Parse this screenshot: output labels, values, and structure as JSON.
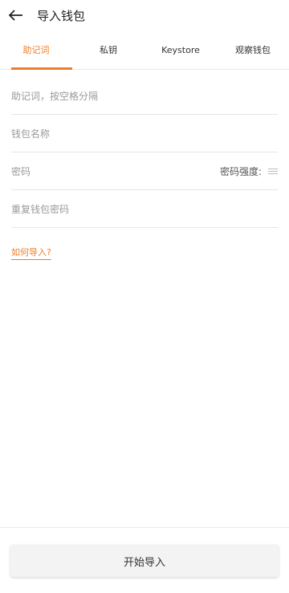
{
  "header": {
    "title": "导入钱包",
    "back_icon": "arrow-left-icon"
  },
  "tabs": [
    {
      "label": "助记词",
      "active": true
    },
    {
      "label": "私钥",
      "active": false
    },
    {
      "label": "Keystore",
      "active": false
    },
    {
      "label": "观察钱包",
      "active": false
    }
  ],
  "form": {
    "mnemonic_placeholder": "助记词，按空格分隔",
    "wallet_name_placeholder": "钱包名称",
    "password_placeholder": "密码",
    "password_strength_label": "密码强度:",
    "repeat_password_placeholder": "重复钱包密码"
  },
  "help_link": "如何导入?",
  "bottom": {
    "start_button_label": "开始导入"
  },
  "colors": {
    "accent": "#ef7d2a"
  }
}
